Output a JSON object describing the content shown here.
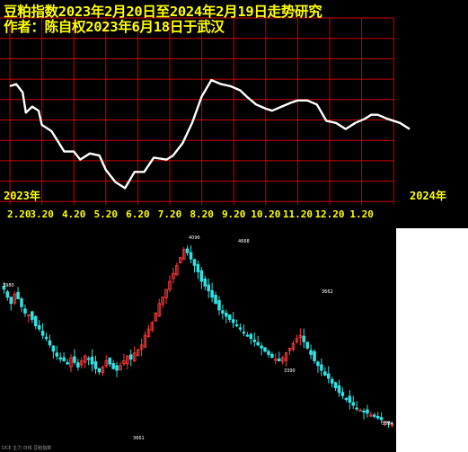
{
  "chart_data": [
    {
      "type": "line",
      "title": "豆粕指数2023年2月20日至2024年2月19日走势研究",
      "subtitle": "作者：陈自权2023年6月18日于武汉",
      "start_year_label": "2023年",
      "end_year_label": "2024年",
      "x_tick_labels": [
        "2.20",
        "3.20",
        "4.20",
        "5.20",
        "6.20",
        "7.20",
        "8.20",
        "9.20",
        "10.20",
        "11.20",
        "12.20",
        "1.20"
      ],
      "grid": true,
      "line_color": "#ffffff",
      "grid_color": "#cc0000",
      "text_color": "#ffff00",
      "x": [
        0,
        0.2,
        0.4,
        0.5,
        0.7,
        0.9,
        1.0,
        1.3,
        1.5,
        1.7,
        2.0,
        2.2,
        2.5,
        2.8,
        3.0,
        3.3,
        3.6,
        3.9,
        4.2,
        4.5,
        4.9,
        5.1,
        5.4,
        5.7,
        6.0,
        6.3,
        6.6,
        6.9,
        7.2,
        7.4,
        7.7,
        8.0,
        8.2,
        8.5,
        8.8,
        9.0,
        9.3,
        9.6,
        9.9,
        10.2,
        10.5,
        10.8,
        11.1,
        11.3,
        11.5,
        11.8,
        12.2,
        12.5
      ],
      "values": [
        6.7,
        6.8,
        6.4,
        5.4,
        5.7,
        5.5,
        4.8,
        4.5,
        4.0,
        3.5,
        3.5,
        3.1,
        3.4,
        3.3,
        2.6,
        2.0,
        1.7,
        2.5,
        2.5,
        3.2,
        3.1,
        3.3,
        3.9,
        4.9,
        6.2,
        7.0,
        6.8,
        6.7,
        6.5,
        6.2,
        5.8,
        5.6,
        5.5,
        5.7,
        5.9,
        6.0,
        6.0,
        5.8,
        5.0,
        4.9,
        4.6,
        4.9,
        5.1,
        5.3,
        5.3,
        5.1,
        4.9,
        4.6
      ]
    },
    {
      "type": "candlestick",
      "up_color": "#ff3b3b",
      "down_color": "#32e0e0",
      "price_labels": [
        "4096",
        "4668",
        "3980",
        "3662",
        "3661",
        "3390",
        "3584"
      ],
      "footer_text": "DCE  主力 日线 豆粕指数",
      "closes": [
        3850,
        3800,
        3760,
        3820,
        3790,
        3740,
        3700,
        3690,
        3660,
        3620,
        3600,
        3560,
        3540,
        3500,
        3460,
        3430,
        3410,
        3400,
        3380,
        3420,
        3390,
        3360,
        3400,
        3430,
        3410,
        3380,
        3350,
        3330,
        3360,
        3400,
        3380,
        3350,
        3340,
        3370,
        3400,
        3430,
        3410,
        3450,
        3470,
        3500,
        3560,
        3600,
        3640,
        3700,
        3760,
        3800,
        3850,
        3900,
        3950,
        4000,
        4050,
        4100,
        4080,
        4040,
        4000,
        3960,
        3900,
        3870,
        3840,
        3800,
        3760,
        3720,
        3700,
        3680,
        3660,
        3640,
        3620,
        3600,
        3580,
        3560,
        3540,
        3520,
        3500,
        3480,
        3460,
        3440,
        3420,
        3410,
        3400,
        3420,
        3450,
        3480,
        3510,
        3540,
        3560,
        3520,
        3480,
        3440,
        3400,
        3370,
        3340,
        3310,
        3290,
        3260,
        3230,
        3200,
        3180,
        3160,
        3140,
        3120,
        3100,
        3090,
        3080,
        3070,
        3060,
        3050,
        3040,
        3030,
        3020,
        3010,
        3005
      ]
    }
  ]
}
